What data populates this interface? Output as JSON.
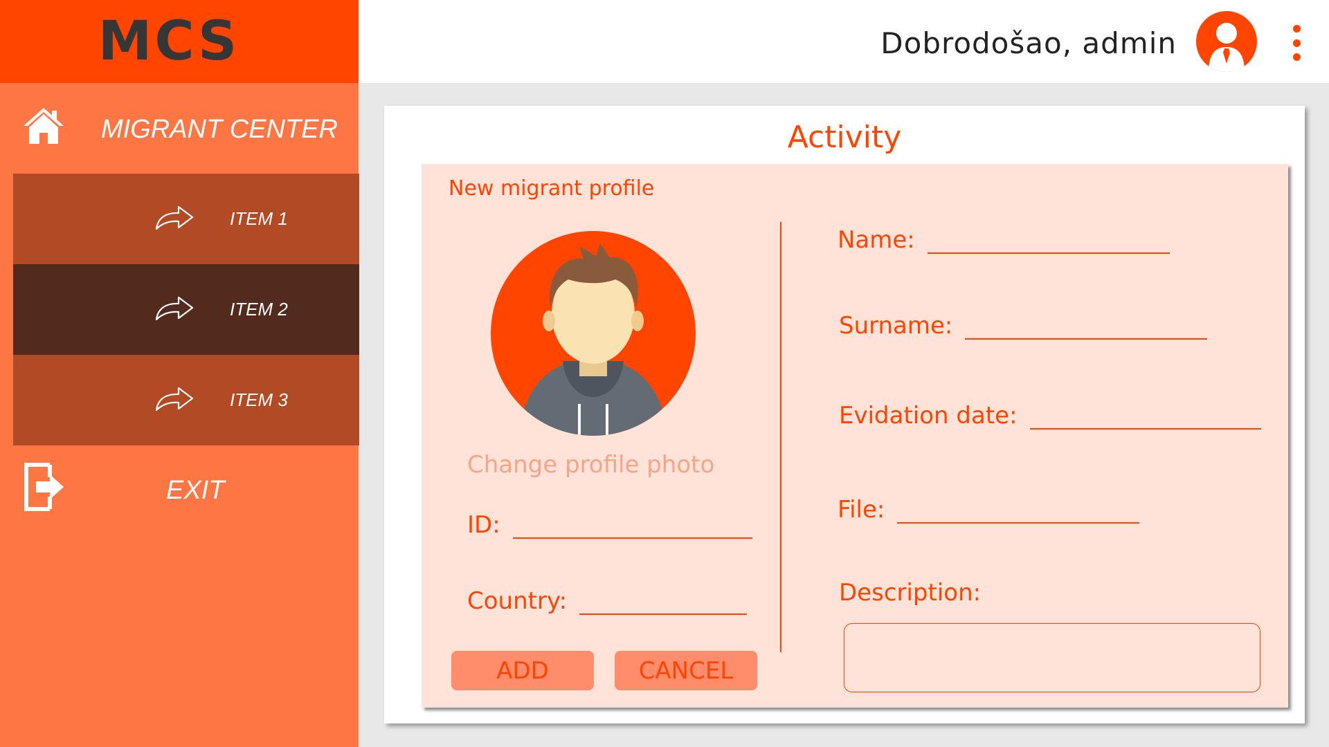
{
  "app": {
    "logo": "MCS"
  },
  "sidebar": {
    "home_label": "MIGRANT CENTER",
    "items": [
      {
        "label": "ITEM 1",
        "active": false
      },
      {
        "label": "ITEM 2",
        "active": true
      },
      {
        "label": "ITEM 3",
        "active": false
      }
    ],
    "exit_label": "EXIT"
  },
  "header": {
    "welcome": "Dobrodošao, admin"
  },
  "main": {
    "title": "Activity",
    "subtitle": "New migrant profile",
    "change_photo": "Change profile photo",
    "fields": {
      "id": {
        "label": "ID:",
        "value": ""
      },
      "country": {
        "label": "Country:",
        "value": ""
      },
      "name": {
        "label": "Name:",
        "value": ""
      },
      "surname": {
        "label": "Surname:",
        "value": ""
      },
      "evidation_date": {
        "label": "Evidation date:",
        "value": ""
      },
      "file": {
        "label": "File:",
        "value": ""
      },
      "description": {
        "label": "Description:",
        "value": ""
      }
    },
    "buttons": {
      "add": "ADD",
      "cancel": "CANCEL"
    }
  },
  "icons": {
    "home": "home-icon",
    "arrow": "share-arrow-icon",
    "exit": "exit-icon",
    "avatar": "user-avatar-icon",
    "menu": "kebab-menu-icon"
  },
  "colors": {
    "accent": "#ff4500",
    "sidebar": "#ff7645",
    "nav_item": "#b34a26",
    "nav_item_active": "#522a1e",
    "panel": "#ffe2d8",
    "button": "#ff8d6c"
  }
}
